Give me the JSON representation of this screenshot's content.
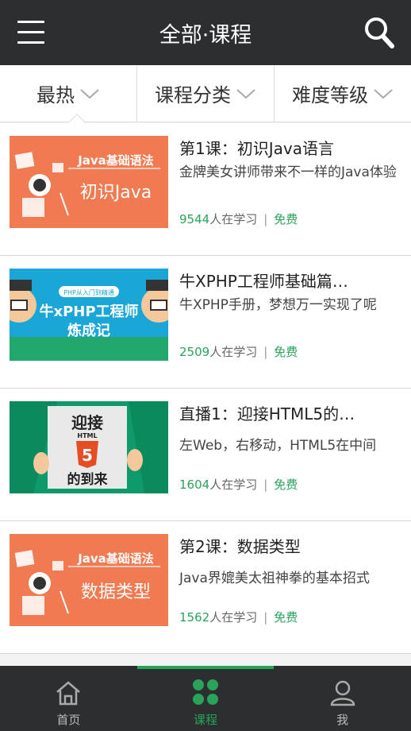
{
  "header": {
    "title": "全部·课程"
  },
  "filters": [
    {
      "label": "最热"
    },
    {
      "label": "课程分类"
    },
    {
      "label": "难度等级"
    }
  ],
  "courses": [
    {
      "title": "第1课：初识Java语言",
      "desc": "金牌美女讲师带来不一样的Java体验",
      "learners": "9544",
      "learners_suffix": "人在学习",
      "separator": "|",
      "price": "免费",
      "thumb": {
        "tag": "Java基础语法",
        "headline": "初识Java"
      }
    },
    {
      "title": "牛XPHP工程师基础篇…",
      "desc": "牛XPHP手册，梦想万一实现了呢",
      "learners": "2509",
      "learners_suffix": "人在学习",
      "separator": "|",
      "price": "免费",
      "thumb": {
        "tag": "PHP从入门到精通",
        "headline1": "牛xPHP工程师",
        "headline2": "炼成记"
      }
    },
    {
      "title": "直播1：迎接HTML5的…",
      "desc": "左Web，右移动，HTML5在中间",
      "learners": "1604",
      "learners_suffix": "人在学习",
      "separator": "|",
      "price": "免费",
      "thumb": {
        "top": "迎接",
        "badge_text": "HTML",
        "badge_num": "5",
        "bottom": "的到来"
      }
    },
    {
      "title": "第2课：数据类型",
      "desc": "Java界媲美太祖神拳的基本招式",
      "learners": "1562",
      "learners_suffix": "人在学习",
      "separator": "|",
      "price": "免费",
      "thumb": {
        "tag": "Java基础语法",
        "headline": "数据类型"
      }
    }
  ],
  "tabbar": [
    {
      "label": "首页",
      "icon": "home-icon",
      "active": false
    },
    {
      "label": "课程",
      "icon": "grid-icon",
      "active": true
    },
    {
      "label": "我",
      "icon": "user-icon",
      "active": false
    }
  ],
  "colors": {
    "accent": "#2aa35a",
    "bar": "#2c2e2f",
    "java_orange": "#f07a52",
    "php_blue": "#1aa6d6"
  }
}
